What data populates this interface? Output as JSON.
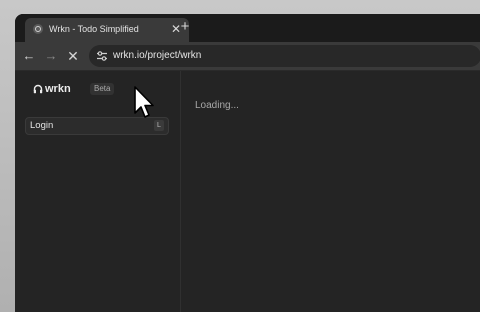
{
  "browser": {
    "tab": {
      "title": "Wrkn - Todo Simplified",
      "close_icon": "close-icon",
      "favicon_icon": "wrkn-favicon-icon"
    },
    "new_tab_icon": "plus-icon",
    "nav": {
      "back_icon": "arrow-left-icon",
      "forward_icon": "arrow-right-icon",
      "stop_icon": "close-icon"
    },
    "address_bar": {
      "site_info_icon": "tune-icon",
      "url": "wrkn.io/project/wrkn"
    }
  },
  "sidebar": {
    "logo_text": "wrkn",
    "beta_badge": "Beta",
    "login": {
      "label": "Login",
      "shortcut": "L"
    }
  },
  "main": {
    "status": "Loading..."
  },
  "colors": {
    "page_background": "#242424",
    "tab_active": "#3a3a3a",
    "toolbar": "#3a3a3a",
    "text_primary": "#e4e4e4",
    "text_muted": "#a8a8a8"
  }
}
